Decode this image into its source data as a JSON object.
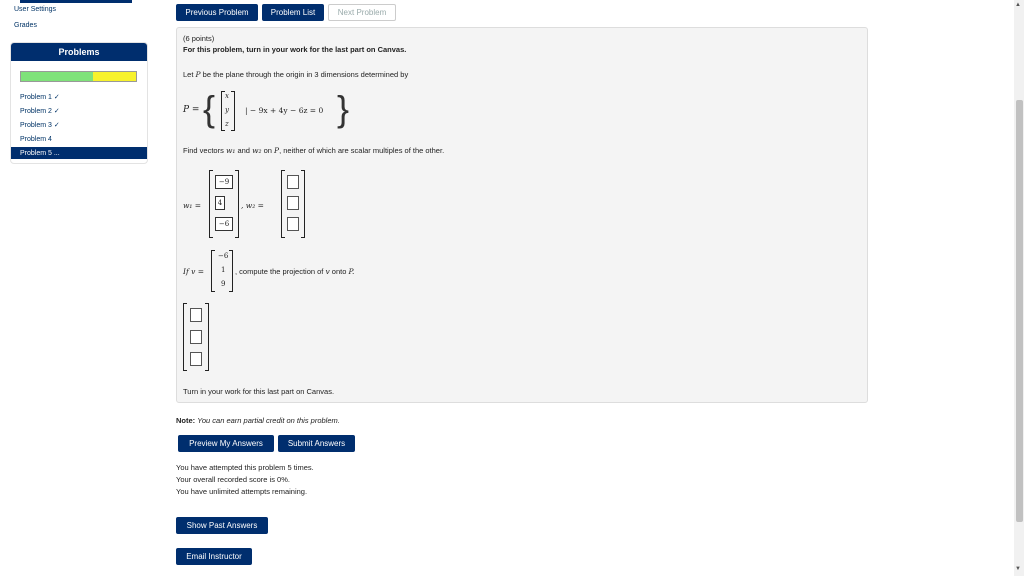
{
  "sidebar": {
    "user_settings": "User Settings",
    "grades": "Grades",
    "heading": "Problems",
    "progress": {
      "green_fraction": 0.63,
      "yellow_fraction": 0.37
    },
    "items": [
      {
        "label": "Problem 1 ✓"
      },
      {
        "label": "Problem 2 ✓"
      },
      {
        "label": "Problem 3 ✓"
      },
      {
        "label": "Problem 4"
      },
      {
        "label": "Problem 5 ..."
      }
    ]
  },
  "nav": {
    "previous": "Previous Problem",
    "list": "Problem List",
    "next": "Next Problem"
  },
  "problem": {
    "points": "(6 points)",
    "instruction": "For this problem, turn in your work for the last part on Canvas.",
    "intro_pre": "Let ",
    "intro_P": "P",
    "intro_post": " be the plane through the origin in 3 dimensions determined by",
    "set_label": "P =",
    "vec_x": "x",
    "vec_y": "y",
    "vec_z": "z",
    "condition": "| − 9x + 4y − 6z = 0",
    "find_text_1": "Find vectors ",
    "w1": "w₁",
    "find_and": " and ",
    "w2": "w₂",
    "find_text_2": " on ",
    "find_P": "P",
    "find_text_3": ", neither of which are scalar multiples of the other.",
    "w1_label": "w₁ =",
    "w1_values": [
      "−9",
      "4",
      "−6"
    ],
    "w2_label": ", w₂ =",
    "if_v": "If v =",
    "v_values": [
      "−6",
      "1",
      "9"
    ],
    "compute_text": ", compute the projection of ",
    "v_sym": "v",
    "onto": " onto ",
    "onto_P": "P.",
    "canvas_note": "Turn in your work for this last part on Canvas."
  },
  "note": {
    "label": "Note:",
    "text": "You can earn partial credit on this problem."
  },
  "buttons": {
    "preview": "Preview My Answers",
    "submit": "Submit Answers",
    "show_past": "Show Past Answers",
    "email": "Email Instructor"
  },
  "status": {
    "attempted": "You have attempted this problem 5 times.",
    "score": "Your overall recorded score is 0%.",
    "remaining": "You have unlimited attempts remaining."
  }
}
